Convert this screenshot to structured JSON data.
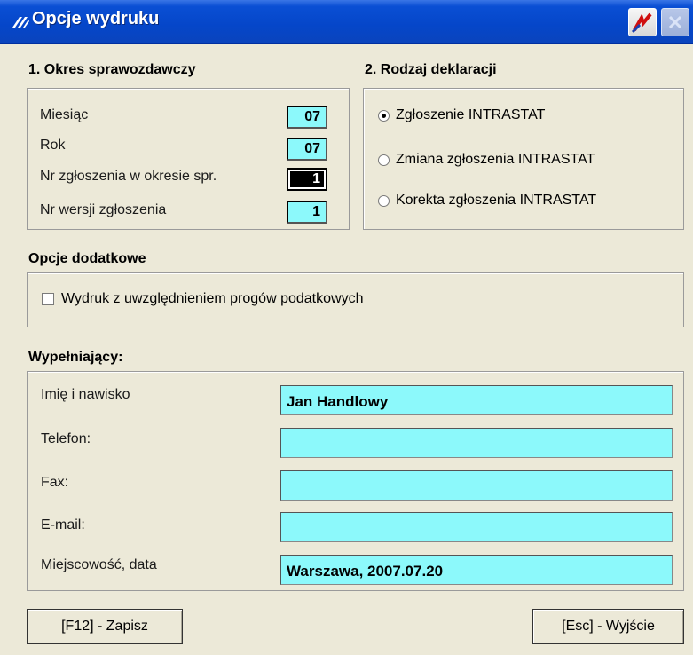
{
  "window": {
    "title": "Opcje wydruku"
  },
  "period": {
    "heading": "1. Okres sprawozdawczy",
    "fields": [
      {
        "label": "Miesiąc",
        "value": "07"
      },
      {
        "label": "Rok",
        "value": "07"
      },
      {
        "label": "Nr zgłoszenia w okresie spr.",
        "value": "1"
      },
      {
        "label": "Nr wersji zgłoszenia",
        "value": "1"
      }
    ]
  },
  "declaration": {
    "heading": "2. Rodzaj deklaracji",
    "options": [
      {
        "label": "Zgłoszenie INTRASTAT",
        "selected": true
      },
      {
        "label": "Zmiana zgłoszenia INTRASTAT",
        "selected": false
      },
      {
        "label": "Korekta zgłoszenia INTRASTAT",
        "selected": false
      }
    ]
  },
  "extra": {
    "heading": "Opcje dodatkowe",
    "checkbox_label": "Wydruk z uwzględnieniem progów podatkowych",
    "checked": false
  },
  "filler": {
    "heading": "Wypełniający:",
    "fields": [
      {
        "label": "Imię i nawisko",
        "value": "Jan Handlowy"
      },
      {
        "label": "Telefon:",
        "value": ""
      },
      {
        "label": "Fax:",
        "value": ""
      },
      {
        "label": "E-mail:",
        "value": ""
      },
      {
        "label": "Miejscowość, data",
        "value": "Warszawa, 2007.07.20"
      }
    ]
  },
  "buttons": {
    "save": "[F12] - Zapisz",
    "exit": "[Esc] - Wyjście"
  },
  "colors": {
    "field_bg": "#8cf9fb",
    "window_bg": "#ece9d8",
    "titlebar": "#0546c9"
  },
  "icons": {
    "app": "app-logo-icon",
    "titlebar_logo": "brand-logo-icon",
    "close": "close-icon"
  }
}
